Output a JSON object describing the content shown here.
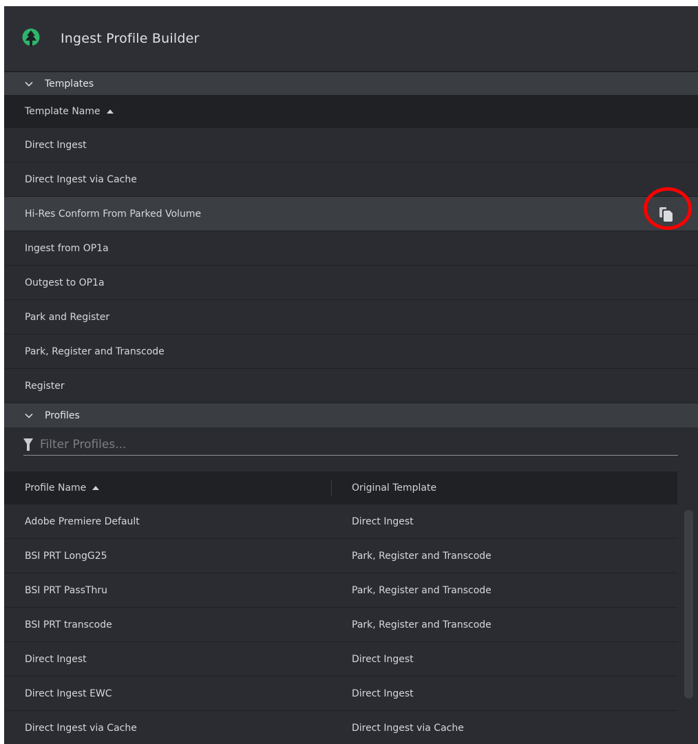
{
  "app": {
    "title": "Ingest Profile Builder",
    "accent_color": "#2fb56b",
    "logo_icon": "tree-icon"
  },
  "templates": {
    "section_label": "Templates",
    "column_header": "Template Name",
    "rows": [
      {
        "name": "Direct Ingest"
      },
      {
        "name": "Direct Ingest via Cache"
      },
      {
        "name": "Hi-Res Conform From Parked Volume",
        "selected": true,
        "action_icon": "copy-icon"
      },
      {
        "name": "Ingest from OP1a"
      },
      {
        "name": "Outgest to OP1a"
      },
      {
        "name": "Park and Register"
      },
      {
        "name": "Park, Register and Transcode"
      },
      {
        "name": "Register"
      }
    ]
  },
  "profiles": {
    "section_label": "Profiles",
    "filter_placeholder": "Filter Profiles...",
    "columns": {
      "name": "Profile Name",
      "template": "Original Template"
    },
    "rows": [
      {
        "name": "Adobe Premiere Default",
        "template": "Direct Ingest"
      },
      {
        "name": "BSI PRT LongG25",
        "template": "Park, Register and Transcode"
      },
      {
        "name": "BSI PRT PassThru",
        "template": "Park, Register and Transcode"
      },
      {
        "name": "BSI PRT transcode",
        "template": "Park, Register and Transcode"
      },
      {
        "name": "Direct Ingest",
        "template": "Direct Ingest"
      },
      {
        "name": "Direct Ingest EWC",
        "template": "Direct Ingest"
      },
      {
        "name": "Direct Ingest via Cache",
        "template": "Direct Ingest via Cache"
      }
    ]
  },
  "annotation": {
    "highlight_color": "#ff0000"
  }
}
